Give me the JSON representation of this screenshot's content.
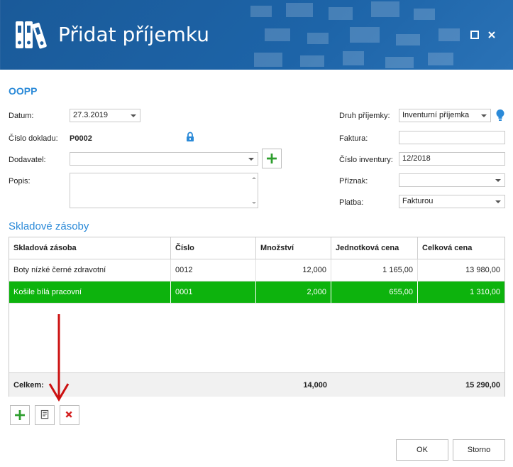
{
  "window": {
    "title": "Přidat příjemku"
  },
  "section_title": "OOPP",
  "form": {
    "datum_label": "Datum:",
    "datum_value": "27.3.2019",
    "cislo_dokladu_label": "Číslo dokladu:",
    "cislo_dokladu_value": "P0002",
    "dodavatel_label": "Dodavatel:",
    "dodavatel_value": "",
    "popis_label": "Popis:",
    "popis_value": "",
    "druh_label": "Druh příjemky:",
    "druh_value": "Inventurní příjemka",
    "faktura_label": "Faktura:",
    "faktura_value": "",
    "cislo_inventury_label": "Číslo inventury:",
    "cislo_inventury_value": "12/2018",
    "priznak_label": "Příznak:",
    "priznak_value": "",
    "platba_label": "Platba:",
    "platba_value": "Fakturou"
  },
  "stock": {
    "title": "Skladové zásoby",
    "columns": [
      "Skladová zásoba",
      "Číslo",
      "Množství",
      "Jednotková cena",
      "Celková cena"
    ],
    "rows": [
      [
        "Boty nízké černé zdravotní",
        "0012",
        "12,000",
        "1 165,00",
        "13 980,00"
      ],
      [
        "Košile bílá pracovní",
        "0001",
        "2,000",
        "655,00",
        "1 310,00"
      ]
    ],
    "footer": {
      "label": "Celkem:",
      "quantity": "14,000",
      "total": "15 290,00"
    }
  },
  "buttons": {
    "ok": "OK",
    "cancel": "Storno"
  },
  "colors": {
    "accent": "#2b8ad8",
    "titlebar": "#1b5c9c",
    "selected_row": "#0db30d",
    "add": "#2e9e2e",
    "delete": "#d42020"
  }
}
